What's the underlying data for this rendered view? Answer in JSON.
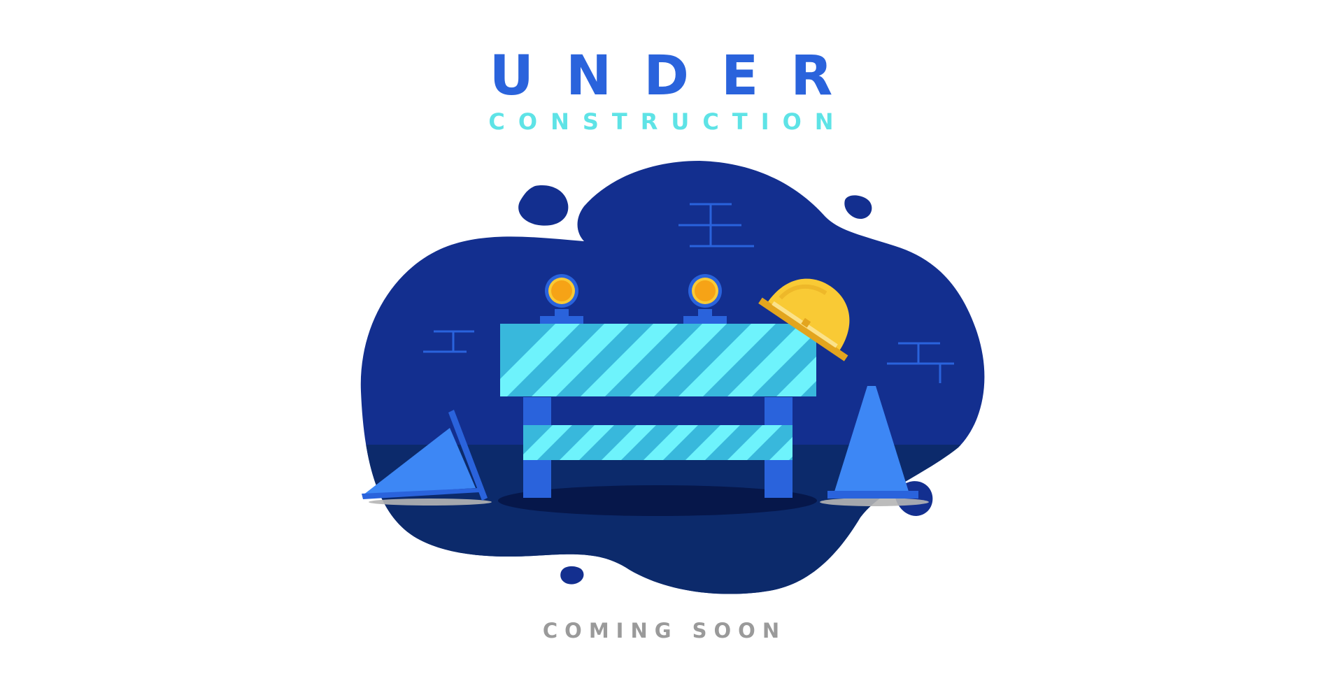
{
  "heading": {
    "line1": "UNDER",
    "line2": "CONSTRUCTION"
  },
  "footer": {
    "text": "COMING SOON"
  },
  "colors": {
    "blob_dark": "#132f8f",
    "blob_floor": "#0c2a6b",
    "primary_blue": "#2a63dc",
    "cyan": "#6ef3fc",
    "cyan_stripe": "#38b8dc",
    "helmet": "#f9ca35",
    "lamp": "#f6a316",
    "cone": "#3d87f5",
    "footer_gray": "#9a9a9a"
  },
  "illustration": {
    "icons": [
      "road-barrier-icon",
      "warning-lamp-icon",
      "hard-hat-icon",
      "traffic-cone-icon",
      "brick-line-icon"
    ]
  }
}
